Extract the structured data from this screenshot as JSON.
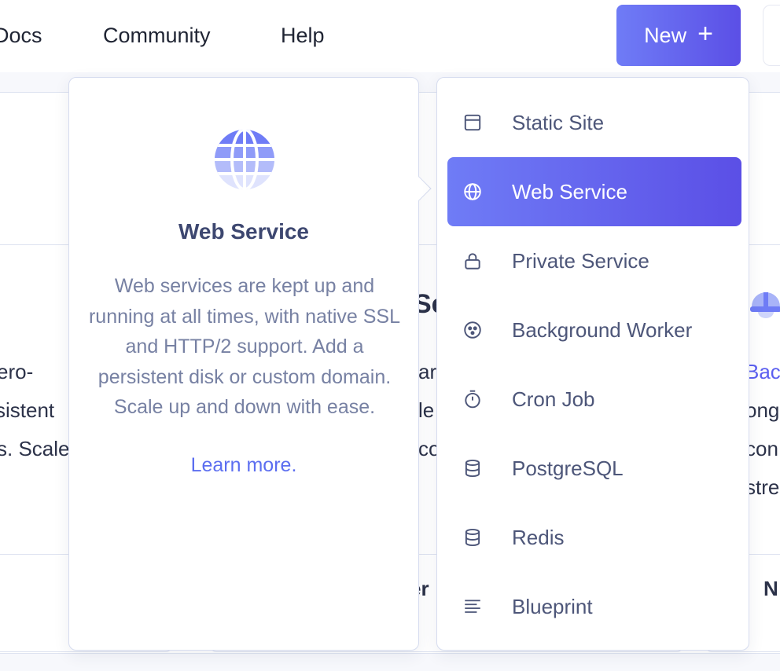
{
  "nav": {
    "links": [
      "Docs",
      "Community",
      "Help"
    ],
    "new_button": {
      "label": "New",
      "icon": "plus-icon"
    }
  },
  "background": {
    "left_text": [
      "ero-",
      "sistent",
      "s. Scale"
    ],
    "middle_heading": "Se",
    "middle_text": [
      "ar",
      "le",
      "co"
    ],
    "middle_footer": "er",
    "right_link": "Bac",
    "right_text": [
      "ong",
      "con",
      "stre"
    ],
    "right_footer": "N"
  },
  "info_card": {
    "icon": "globe-icon",
    "title": "Web Service",
    "description": "Web services are kept up and running at all times, with native SSL and HTTP/2 support. Add a persistent disk or custom domain. Scale up and down with ease.",
    "link": "Learn more."
  },
  "menu": {
    "items": [
      {
        "label": "Static Site",
        "icon": "browser-window-icon",
        "active": false
      },
      {
        "label": "Web Service",
        "icon": "globe-icon",
        "active": true
      },
      {
        "label": "Private Service",
        "icon": "lock-icon",
        "active": false
      },
      {
        "label": "Background Worker",
        "icon": "gear-cog-icon",
        "active": false
      },
      {
        "label": "Cron Job",
        "icon": "stopwatch-icon",
        "active": false
      },
      {
        "label": "PostgreSQL",
        "icon": "database-icon",
        "active": false
      },
      {
        "label": "Redis",
        "icon": "database-icon",
        "active": false
      },
      {
        "label": "Blueprint",
        "icon": "lines-icon",
        "active": false
      }
    ]
  },
  "colors": {
    "accent_start": "#6f7cf6",
    "accent_end": "#5b4fe6",
    "link": "#5c6ef0",
    "text_muted": "#7781a3"
  }
}
